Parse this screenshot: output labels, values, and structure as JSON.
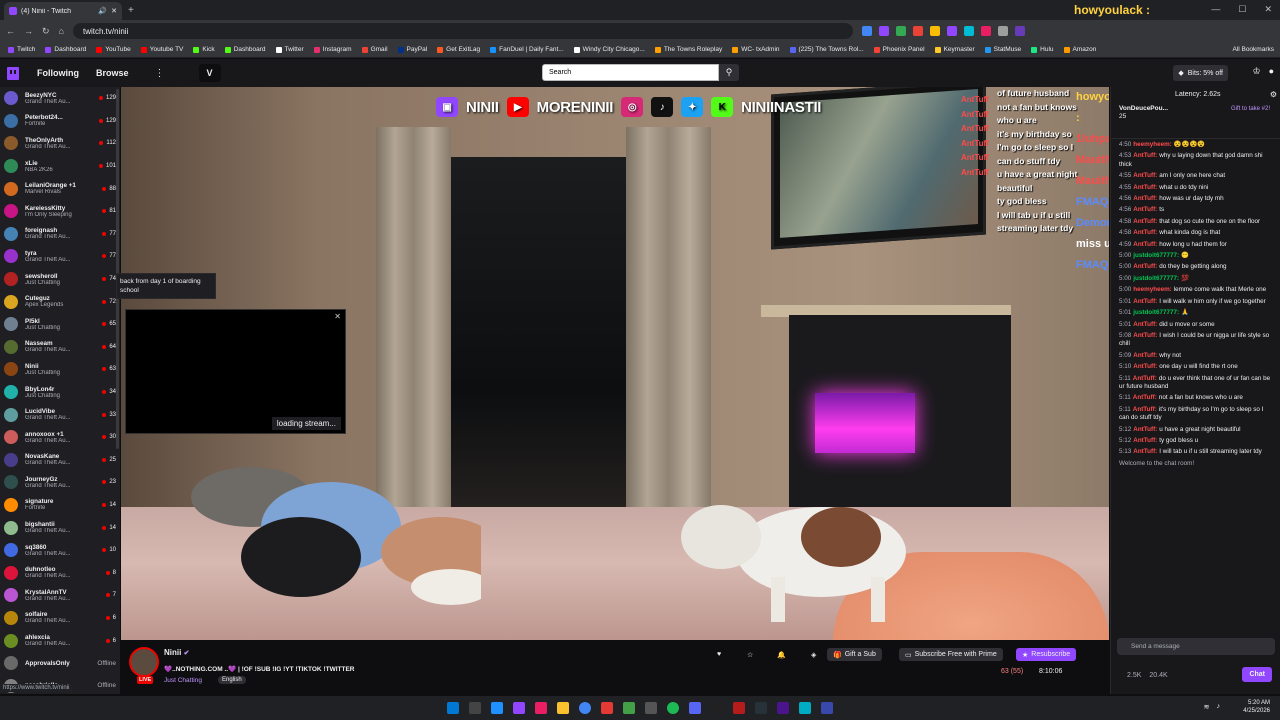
{
  "browser": {
    "tab_title": "(4) Ninii - Twitch",
    "url": "twitch.tv/ninii",
    "bookmarks": [
      "Twitch",
      "Dashboard",
      "YouTube",
      "Youtube TV",
      "Kick",
      "Dashboard",
      "Twitter",
      "Instagram",
      "Gmail",
      "PayPal",
      "Get ExitLag",
      "FanDuel | Daily Fant...",
      "Windy City Chicago...",
      "The Towns Roleplay",
      "WC- txAdmin",
      "(225) The Towns Rol...",
      "Phoenix Panel",
      "Keymaster",
      "StatMuse",
      "Hulu",
      "Amazon"
    ],
    "all_bookmarks": "All Bookmarks",
    "overlay_username": "howyoulack : "
  },
  "header": {
    "following": "Following",
    "browse": "Browse",
    "more": "⋮",
    "search_placeholder": "Search",
    "bits": "Bits: 5% off"
  },
  "sidebar": {
    "channels": [
      {
        "name": "BeezyNYC",
        "game": "Grand Theft Au...",
        "viewers": "129",
        "color": "#6a5acd"
      },
      {
        "name": "Peterbot24...",
        "game": "Fortnite",
        "viewers": "129",
        "color": "#3a6ea5"
      },
      {
        "name": "TheOnlyArth",
        "game": "Grand Theft Au...",
        "viewers": "112",
        "color": "#8b5a2b"
      },
      {
        "name": "xLie",
        "game": "NBA 2K26",
        "viewers": "101",
        "color": "#2e8b57"
      },
      {
        "name": "LeilaniOrange +1",
        "game": "Marvel Rivals",
        "viewers": "88",
        "color": "#d2691e"
      },
      {
        "name": "KareiessKitty",
        "game": "I'm Only Sleeping",
        "viewers": "81",
        "color": "#c71585"
      },
      {
        "name": "foreignash",
        "game": "Grand Theft Au...",
        "viewers": "77",
        "color": "#4682b4"
      },
      {
        "name": "tyra",
        "game": "Grand Theft Au...",
        "viewers": "77",
        "color": "#9932cc"
      },
      {
        "name": "sewsheroll",
        "game": "Just Chatting",
        "viewers": "74",
        "color": "#b22222"
      },
      {
        "name": "Cuteguz",
        "game": "Apex Legends",
        "viewers": "72",
        "color": "#daa520"
      },
      {
        "name": "Pl5kl",
        "game": "Just Chatting",
        "viewers": "65",
        "color": "#708090"
      },
      {
        "name": "Nasseam",
        "game": "Grand Theft Au...",
        "viewers": "64",
        "color": "#556b2f"
      },
      {
        "name": "Ninii",
        "game": "Just Chatting",
        "viewers": "63",
        "color": "#8b4513"
      },
      {
        "name": "BbyLon4r",
        "game": "Just Chatting",
        "viewers": "34",
        "color": "#20b2aa"
      },
      {
        "name": "LucidVibe",
        "game": "Grand Theft Au...",
        "viewers": "33",
        "color": "#5f9ea0"
      },
      {
        "name": "annoxoox +1",
        "game": "Grand Theft Au...",
        "viewers": "30",
        "color": "#cd5c5c"
      },
      {
        "name": "NovasKane",
        "game": "Grand Theft Au...",
        "viewers": "25",
        "color": "#483d8b"
      },
      {
        "name": "JourneyGz",
        "game": "Grand Theft Au...",
        "viewers": "23",
        "color": "#2f4f4f"
      },
      {
        "name": "signature",
        "game": "Fortnite",
        "viewers": "14",
        "color": "#ff8c00"
      },
      {
        "name": "bigshantii",
        "game": "Grand Theft Au...",
        "viewers": "14",
        "color": "#8fbc8f"
      },
      {
        "name": "sq3860",
        "game": "Grand Theft Au...",
        "viewers": "10",
        "color": "#4169e1"
      },
      {
        "name": "duhnotleo",
        "game": "Grand Theft Au...",
        "viewers": "8",
        "color": "#dc143c"
      },
      {
        "name": "KrystalAnnTV",
        "game": "Grand Theft Au...",
        "viewers": "7",
        "color": "#ba55d3"
      },
      {
        "name": "solfaire",
        "game": "Grand Theft Au...",
        "viewers": "6",
        "color": "#b8860b"
      },
      {
        "name": "ahlexcia",
        "game": "Grand Theft Au...",
        "viewers": "6",
        "color": "#6b8e23"
      },
      {
        "name": "ApprovalsOnly",
        "game": "",
        "viewers": "Offline",
        "color": "#696969"
      },
      {
        "name": "pacabrielle",
        "game": "",
        "viewers": "Offline",
        "color": "#808080"
      }
    ],
    "tooltip": "back from day 1 of boarding school",
    "status_url": "https://www.twitch.tv/ninii"
  },
  "video": {
    "banner": {
      "twitch": "NINII",
      "youtube": "MORENINII",
      "kick": "NINIINASTII"
    },
    "overlay_chat": [
      "of future husband",
      "not a fan but knows",
      "who u are",
      "it's my birthday so",
      "I'm go to sleep so I",
      "can do stuff tdy",
      "u have a great night",
      "beautiful",
      "ty god bless",
      "I will tab u if u still",
      "streaming later tdy"
    ],
    "overlay_names": [
      "AntTuff",
      "AntTuff",
      "AntTuff",
      "AntTuff",
      "AntTuff",
      "AntTuff"
    ],
    "overlay_side": [
      "howyoulack :",
      "1luhpat",
      "Mauith :",
      "Mauith :",
      "FMAQuis :",
      "Demond :",
      "FMAQuis :"
    ],
    "overlay_miss": "i miss u",
    "pip_loading": "loading stream..."
  },
  "info": {
    "streamer": "Ninii",
    "live": "LIVE",
    "title": "💜..NOTHING.COM ..💜 | !OF !SUB !IG !YT !TIKTOK !TWITTER",
    "category": "Just Chatting",
    "language": "English",
    "gift_sub": "Gift a Sub",
    "subscribe_prime": "Subscribe Free with Prime",
    "resubscribe": "Resubscribe",
    "viewers": "63 (55)",
    "uptime": "8:10:06"
  },
  "chat": {
    "latency": "Latency: 2.62s",
    "pinned_user": "VonDeucePou...",
    "pinned_count": "25",
    "gift_to_take": "Gift to take #2!",
    "messages": [
      {
        "time": "4:50",
        "user": "heemyheem:",
        "color": "#ff4b4b",
        "text": "😵😵😵😵"
      },
      {
        "time": "4:53",
        "user": "AntTuff:",
        "color": "#ff4b4b",
        "text": "why u laying down that god damn shi thick"
      },
      {
        "time": "4:55",
        "user": "AntTuff:",
        "color": "#ff4b4b",
        "text": "am I only one here chat"
      },
      {
        "time": "4:55",
        "user": "AntTuff:",
        "color": "#ff4b4b",
        "text": "what u do tdy nini"
      },
      {
        "time": "4:56",
        "user": "AntTuff:",
        "color": "#ff4b4b",
        "text": "how was ur day tdy mh"
      },
      {
        "time": "4:56",
        "user": "AntTuff:",
        "color": "#ff4b4b",
        "text": "ts"
      },
      {
        "time": "4:58",
        "user": "AntTuff:",
        "color": "#ff4b4b",
        "text": "that dog so cute the one on the floor"
      },
      {
        "time": "4:58",
        "user": "AntTuff:",
        "color": "#ff4b4b",
        "text": "what kinda dog is that"
      },
      {
        "time": "4:59",
        "user": "AntTuff:",
        "color": "#ff4b4b",
        "text": "how long u had them for"
      },
      {
        "time": "5:00",
        "user": "justdoit677777:",
        "color": "#00c853",
        "text": "😶"
      },
      {
        "time": "5:00",
        "user": "AntTuff:",
        "color": "#ff4b4b",
        "text": "do they be getting along"
      },
      {
        "time": "5:00",
        "user": "justdoit677777:",
        "color": "#00c853",
        "text": "💯"
      },
      {
        "time": "5:00",
        "user": "heemyheem:",
        "color": "#ff4b4b",
        "text": "lemme come walk that Merle one"
      },
      {
        "time": "5:01",
        "user": "AntTuff:",
        "color": "#ff4b4b",
        "text": "I will walk w him only if we go together"
      },
      {
        "time": "5:01",
        "user": "justdoit677777:",
        "color": "#00c853",
        "text": "🙏"
      },
      {
        "time": "5:01",
        "user": "AntTuff:",
        "color": "#ff4b4b",
        "text": "did u move or some"
      },
      {
        "time": "5:08",
        "user": "AntTuff:",
        "color": "#ff4b4b",
        "text": "I wish I could be ur nigga ur life style so chill"
      },
      {
        "time": "5:09",
        "user": "AntTuff:",
        "color": "#ff4b4b",
        "text": "why not"
      },
      {
        "time": "5:10",
        "user": "AntTuff:",
        "color": "#ff4b4b",
        "text": "one day u will find the rt one"
      },
      {
        "time": "5:11",
        "user": "AntTuff:",
        "color": "#ff4b4b",
        "text": "do u ever think that one of ur fan can be ur future husband"
      },
      {
        "time": "5:11",
        "user": "AntTuff:",
        "color": "#ff4b4b",
        "text": "not a fan but knows who u are"
      },
      {
        "time": "5:11",
        "user": "AntTuff:",
        "color": "#ff4b4b",
        "text": "it's my birthday so I'm go to sleep so I can do stuff tdy"
      },
      {
        "time": "5:12",
        "user": "AntTuff:",
        "color": "#ff4b4b",
        "text": "u have a great night beautiful"
      },
      {
        "time": "5:12",
        "user": "AntTuff:",
        "color": "#ff4b4b",
        "text": "ty god bless u"
      },
      {
        "time": "5:13",
        "user": "AntTuff:",
        "color": "#ff4b4b",
        "text": "I will tab u if u still streaming later tdy"
      }
    ],
    "welcome": "Welcome to the chat room!",
    "input_placeholder": "Send a message",
    "points": "2.5K",
    "points2": "20.4K",
    "send": "Chat"
  },
  "taskbar": {
    "time": "5:20 AM",
    "date": "4/25/2026"
  }
}
